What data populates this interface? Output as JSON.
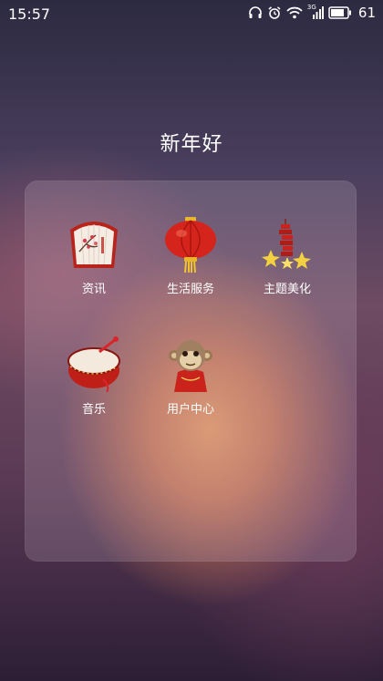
{
  "status_bar": {
    "time": "15:57",
    "network_label": "3G",
    "battery": "61",
    "icons": [
      "headphones-icon",
      "alarm-icon",
      "wifi-icon",
      "signal-icon",
      "battery-icon"
    ]
  },
  "folder": {
    "title": "新年好",
    "apps": [
      {
        "label": "资讯",
        "icon": "paper-fan-icon"
      },
      {
        "label": "生活服务",
        "icon": "red-lantern-icon"
      },
      {
        "label": "主题美化",
        "icon": "firecracker-icon"
      },
      {
        "label": "音乐",
        "icon": "drum-icon"
      },
      {
        "label": "用户中心",
        "icon": "monkey-icon"
      }
    ]
  },
  "colors": {
    "panel": "#e6d2e1",
    "lantern_red": "#d4241c",
    "gold": "#f2c230"
  }
}
